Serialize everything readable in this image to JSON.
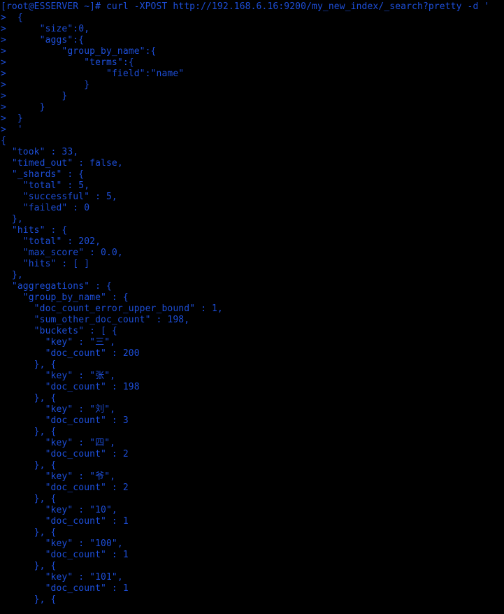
{
  "terminal": {
    "window_title": "root@ESSERVER:~",
    "background_color": "#000000",
    "foreground_color": "#1d4ed8",
    "prompt": "[root@ESSERVER ~]#",
    "user": "root",
    "host": "ESSERVER",
    "cwd": "~",
    "continuation_prompt": ">",
    "command": "curl -XPOST http://192.168.6.16:9200/my_new_index/_search?pretty -d '",
    "command_line": "[root@ESSERVER ~]# curl -XPOST http://192.168.6.16:9200/my_new_index/_search?pretty -d '",
    "request_url": "http://192.168.6.16:9200/my_new_index/_search?pretty",
    "http_method": "-XPOST",
    "index_name": "my_new_index",
    "request_body_lines": [
      ">  {",
      ">      \"size\":0,",
      ">      \"aggs\":{",
      ">          \"group_by_name\":{",
      ">              \"terms\":{",
      ">                  \"field\":\"name\"",
      ">              }",
      ">          }",
      ">      }",
      ">  }",
      ">  '"
    ],
    "response_lines": [
      "{",
      "  \"took\" : 33,",
      "  \"timed_out\" : false,",
      "  \"_shards\" : {",
      "    \"total\" : 5,",
      "    \"successful\" : 5,",
      "    \"failed\" : 0",
      "  },",
      "  \"hits\" : {",
      "    \"total\" : 202,",
      "    \"max_score\" : 0.0,",
      "    \"hits\" : [ ]",
      "  },",
      "  \"aggregations\" : {",
      "    \"group_by_name\" : {",
      "      \"doc_count_error_upper_bound\" : 1,",
      "      \"sum_other_doc_count\" : 198,",
      "      \"buckets\" : [ {",
      "        \"key\" : \"三\",",
      "        \"doc_count\" : 200",
      "      }, {",
      "        \"key\" : \"张\",",
      "        \"doc_count\" : 198",
      "      }, {",
      "        \"key\" : \"刘\",",
      "        \"doc_count\" : 3",
      "      }, {",
      "        \"key\" : \"四\",",
      "        \"doc_count\" : 2",
      "      }, {",
      "        \"key\" : \"爷\",",
      "        \"doc_count\" : 2",
      "      }, {",
      "        \"key\" : \"10\",",
      "        \"doc_count\" : 1",
      "      }, {",
      "        \"key\" : \"100\",",
      "        \"doc_count\" : 1",
      "      }, {",
      "        \"key\" : \"101\",",
      "        \"doc_count\" : 1",
      "      }, {"
    ],
    "response_summary": {
      "took": 33,
      "timed_out": "false",
      "shards_total": 5,
      "shards_successful": 5,
      "shards_failed": 0,
      "hits_total": 202,
      "max_score": "0.0",
      "hits_array": "[ ]",
      "aggregation_name": "group_by_name",
      "doc_count_error_upper_bound": 1,
      "sum_other_doc_count": 198
    },
    "buckets": [
      {
        "key": "三",
        "doc_count": 200
      },
      {
        "key": "张",
        "doc_count": 198
      },
      {
        "key": "刘",
        "doc_count": 3
      },
      {
        "key": "四",
        "doc_count": 2
      },
      {
        "key": "爷",
        "doc_count": 2
      },
      {
        "key": "10",
        "doc_count": 1
      },
      {
        "key": "100",
        "doc_count": 1
      },
      {
        "key": "101",
        "doc_count": 1
      }
    ],
    "all_lines": [
      "[root@ESSERVER ~]# curl -XPOST http://192.168.6.16:9200/my_new_index/_search?pretty -d '",
      ">  {",
      ">      \"size\":0,",
      ">      \"aggs\":{",
      ">          \"group_by_name\":{",
      ">              \"terms\":{",
      ">                  \"field\":\"name\"",
      ">              }",
      ">          }",
      ">      }",
      ">  }",
      ">  '",
      "{",
      "  \"took\" : 33,",
      "  \"timed_out\" : false,",
      "  \"_shards\" : {",
      "    \"total\" : 5,",
      "    \"successful\" : 5,",
      "    \"failed\" : 0",
      "  },",
      "  \"hits\" : {",
      "    \"total\" : 202,",
      "    \"max_score\" : 0.0,",
      "    \"hits\" : [ ]",
      "  },",
      "  \"aggregations\" : {",
      "    \"group_by_name\" : {",
      "      \"doc_count_error_upper_bound\" : 1,",
      "      \"sum_other_doc_count\" : 198,",
      "      \"buckets\" : [ {",
      "        \"key\" : \"三\",",
      "        \"doc_count\" : 200",
      "      }, {",
      "        \"key\" : \"张\",",
      "        \"doc_count\" : 198",
      "      }, {",
      "        \"key\" : \"刘\",",
      "        \"doc_count\" : 3",
      "      }, {",
      "        \"key\" : \"四\",",
      "        \"doc_count\" : 2",
      "      }, {",
      "        \"key\" : \"爷\",",
      "        \"doc_count\" : 2",
      "      }, {",
      "        \"key\" : \"10\",",
      "        \"doc_count\" : 1",
      "      }, {",
      "        \"key\" : \"100\",",
      "        \"doc_count\" : 1",
      "      }, {",
      "        \"key\" : \"101\",",
      "        \"doc_count\" : 1",
      "      }, {"
    ]
  }
}
